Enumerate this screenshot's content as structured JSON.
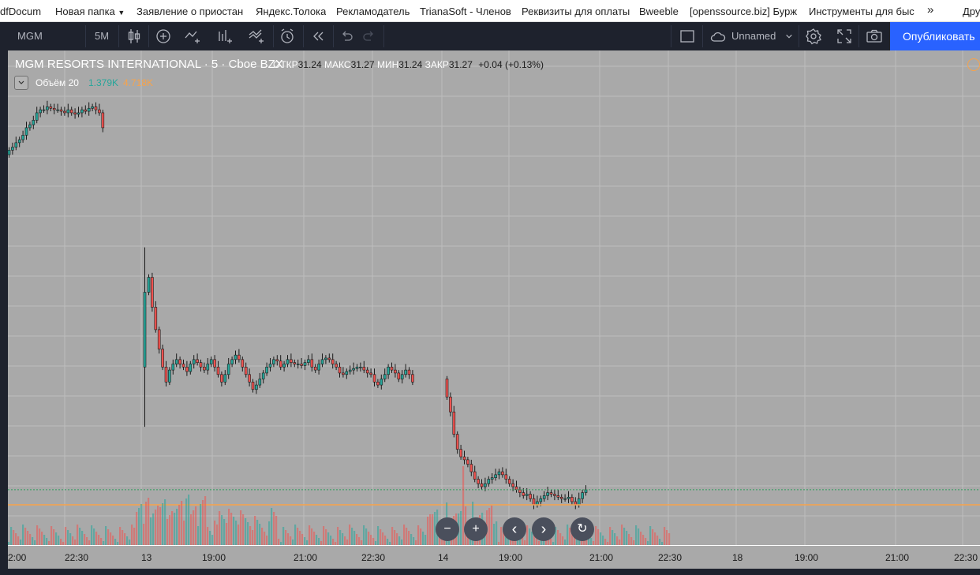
{
  "bookmarks": [
    {
      "label": "dfDocum"
    },
    {
      "label": "Новая папка"
    },
    {
      "label": "Заявление о приостан"
    },
    {
      "label": "Яндекс.Толока"
    },
    {
      "label": "Рекламодатель"
    },
    {
      "label": "TrianaSoft - Членов"
    },
    {
      "label": "Реквизиты для оплаты"
    },
    {
      "label": "Bweeble"
    },
    {
      "label": "[openssource.biz] Бурж"
    },
    {
      "label": "Инструменты для быс"
    },
    {
      "label": "»"
    },
    {
      "label": "Дру"
    }
  ],
  "toolbar": {
    "symbol": "MGM",
    "interval": "5M",
    "layout_name": "Unnamed",
    "publish_label": "Опубликовать",
    "icons": [
      "candles-icon",
      "add-indicator-icon",
      "compare-icon",
      "indicators-icon",
      "templates-icon",
      "alert-icon",
      "replay-icon",
      "undo-icon",
      "redo-icon",
      "layout-square-icon",
      "cloud-icon",
      "chevron-down-icon",
      "settings-icon",
      "fullscreen-icon",
      "camera-icon"
    ]
  },
  "legend": {
    "title": "MGM RESORTS INTERNATIONAL · 5 · Cboe BZX",
    "open_label": "ОТКР",
    "open": "31.24",
    "high_label": "МАКС",
    "high": "31.27",
    "low_label": "МИН",
    "low": "31.24",
    "close_label": "ЗАКР",
    "close": "31.27",
    "change": "+0.04 (+0.13%)",
    "volume_title": "Объём 20",
    "volume_value": "1.379K",
    "volume_ma": "4.718K"
  },
  "time_axis": [
    "2:00",
    "22:30",
    "13",
    "19:00",
    "21:00",
    "22:30",
    "14",
    "19:00",
    "21:00",
    "22:30",
    "18",
    "19:00",
    "21:00",
    "22:30"
  ],
  "nav": {
    "zoom_out": "−",
    "zoom_in": "+",
    "left": "‹",
    "right": "›",
    "reset": "↻"
  },
  "colors": {
    "up": "#26a69a",
    "down": "#ef5350",
    "pane": "#a9a9a9",
    "accent": "#2962ff",
    "orange": "#f7a34b"
  },
  "chart_data": {
    "type": "candlestick",
    "symbol": "MGM",
    "interval": "5",
    "exchange": "Cboe BZX",
    "day1_closes": [
      30.95,
      30.97,
      31.0,
      31.02,
      31.05,
      31.1,
      31.12,
      31.15,
      31.2,
      31.22,
      31.22,
      31.24,
      31.23,
      31.22,
      31.22,
      31.21,
      31.2,
      31.22,
      31.2,
      31.19,
      31.2,
      31.22,
      31.21,
      31.23,
      31.24,
      31.22,
      31.2,
      31.1
    ],
    "day2_closes": [
      30.1,
      29.9,
      29.75,
      29.62,
      29.5,
      29.4,
      29.48,
      29.52,
      29.55,
      29.52,
      29.5,
      29.47,
      29.52,
      29.55,
      29.53,
      29.5,
      29.48,
      29.52,
      29.55,
      29.5,
      29.45,
      29.4,
      29.45,
      29.52,
      29.55,
      29.58,
      29.55,
      29.5,
      29.45,
      29.4,
      29.35,
      29.38,
      29.42,
      29.46,
      29.5,
      29.52,
      29.55,
      29.54,
      29.5,
      29.52,
      29.55,
      29.53,
      29.52,
      29.52,
      29.51,
      29.53,
      29.55,
      29.5,
      29.48,
      29.52,
      29.55,
      29.56,
      29.55,
      29.52,
      29.5,
      29.46,
      29.45,
      29.47,
      29.48,
      29.49,
      29.5,
      29.5,
      29.48,
      29.46,
      29.45,
      29.4,
      29.38,
      29.42,
      29.45,
      29.5,
      29.48,
      29.46,
      29.42,
      29.45,
      29.48,
      29.45,
      29.4
    ],
    "day3_closes": [
      29.3,
      29.2,
      29.05,
      28.95,
      28.9,
      28.88,
      28.85,
      28.8,
      28.75,
      28.72,
      28.7,
      28.72,
      28.75,
      28.76,
      28.78,
      28.8,
      28.78,
      28.75,
      28.72,
      28.7,
      28.68,
      28.66,
      28.64,
      28.65,
      28.62,
      28.58,
      28.6,
      28.62,
      28.64,
      28.66,
      28.65,
      28.64,
      28.63,
      28.62,
      28.62,
      28.63,
      28.6,
      28.58,
      28.62,
      28.66,
      28.68
    ],
    "volume_note": "volume histogram along bottom; spikes near '13' and '14' session opens"
  }
}
